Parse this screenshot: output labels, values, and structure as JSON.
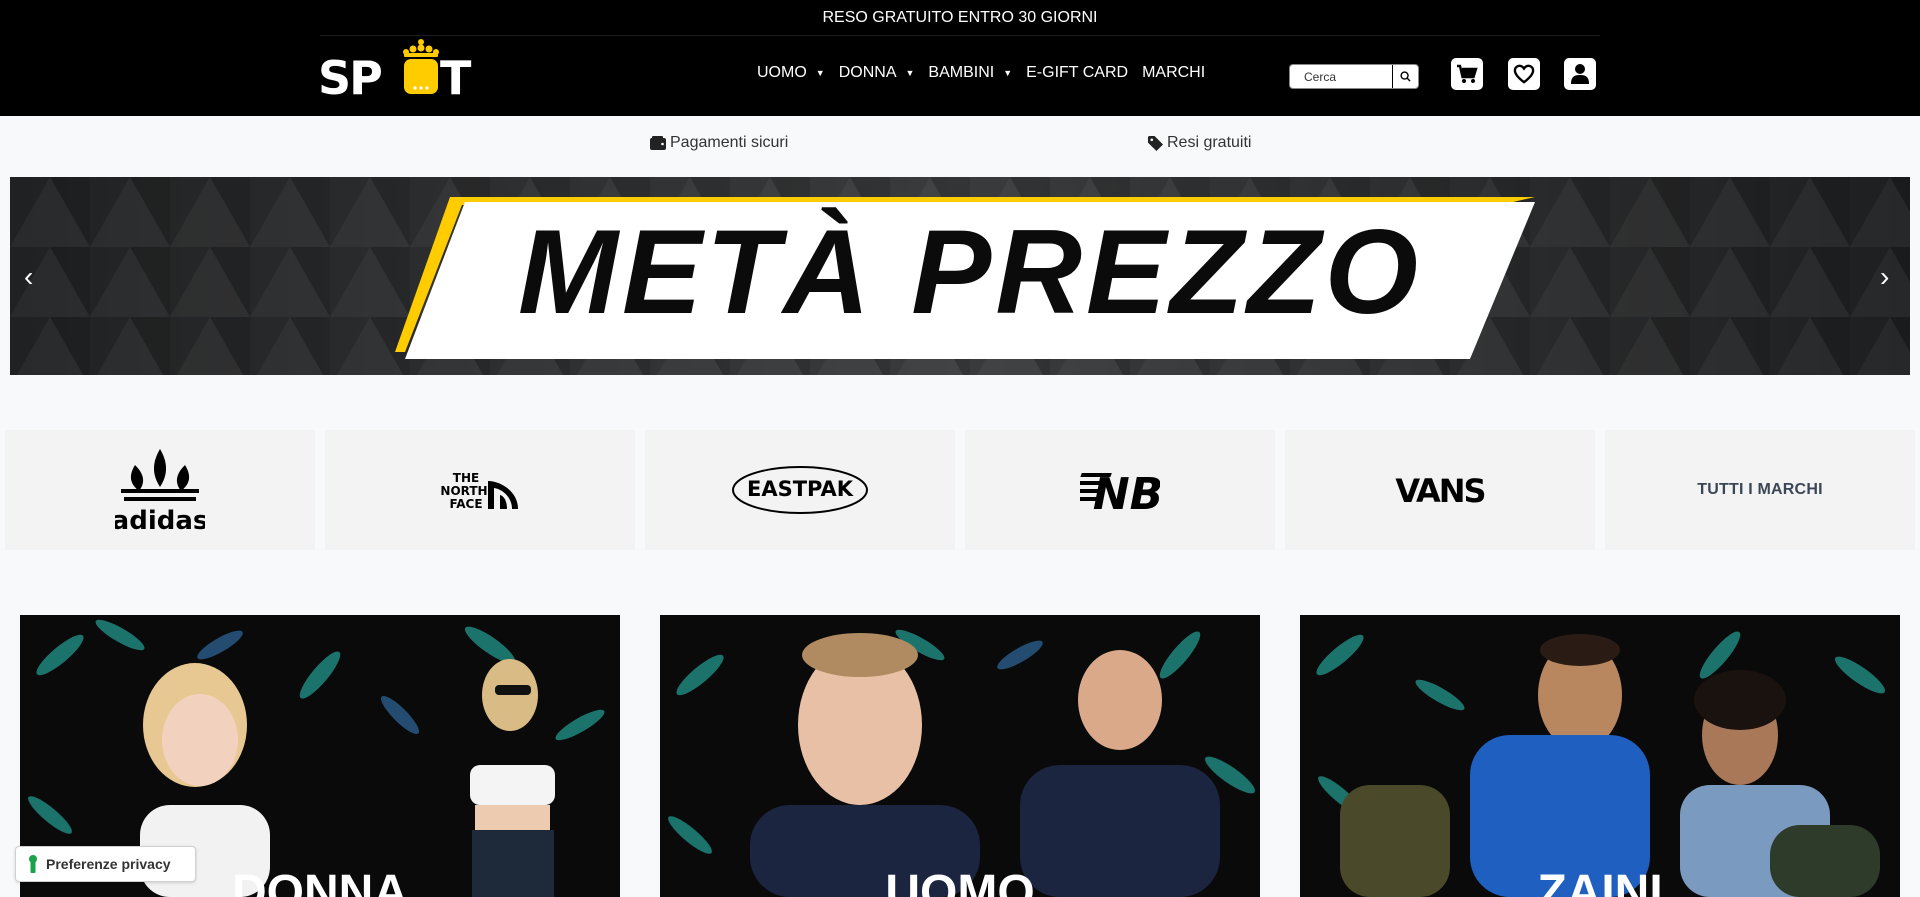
{
  "announcement": "RESO GRATUITO ENTRO 30 GIORNI",
  "logo": {
    "text": "SPOT",
    "accent_color": "#ffcc00"
  },
  "nav": [
    {
      "label": "UOMO",
      "has_dropdown": true
    },
    {
      "label": "DONNA",
      "has_dropdown": true
    },
    {
      "label": "BAMBINI",
      "has_dropdown": true
    },
    {
      "label": "E-GIFT CARD",
      "has_dropdown": false
    },
    {
      "label": "MARCHI",
      "has_dropdown": false
    }
  ],
  "search": {
    "placeholder": "Cerca",
    "icon": "search-icon"
  },
  "header_icons": [
    "cart-icon",
    "heart-icon",
    "user-icon"
  ],
  "benefits": [
    {
      "icon": "wallet-icon",
      "label": "Pagamenti sicuri"
    },
    {
      "icon": "tag-icon",
      "label": "Resi gratuiti"
    }
  ],
  "hero": {
    "title": "METÀ PREZZO",
    "accent_color": "#ffcc00"
  },
  "brands": [
    {
      "name": "adidas",
      "icon": "adidas-logo"
    },
    {
      "name": "THE NORTH FACE",
      "icon": "the-north-face-logo"
    },
    {
      "name": "EASTPAK",
      "icon": "eastpak-logo"
    },
    {
      "name": "NB",
      "icon": "new-balance-logo"
    },
    {
      "name": "VANS",
      "icon": "vans-logo"
    },
    {
      "name": "TUTTI I MARCHI",
      "icon": null
    }
  ],
  "categories": [
    {
      "label": "DONNA"
    },
    {
      "label": "UOMO"
    },
    {
      "label": "ZAINI"
    }
  ],
  "privacy": {
    "label": "Preferenze privacy",
    "icon": "keyhole-icon"
  }
}
